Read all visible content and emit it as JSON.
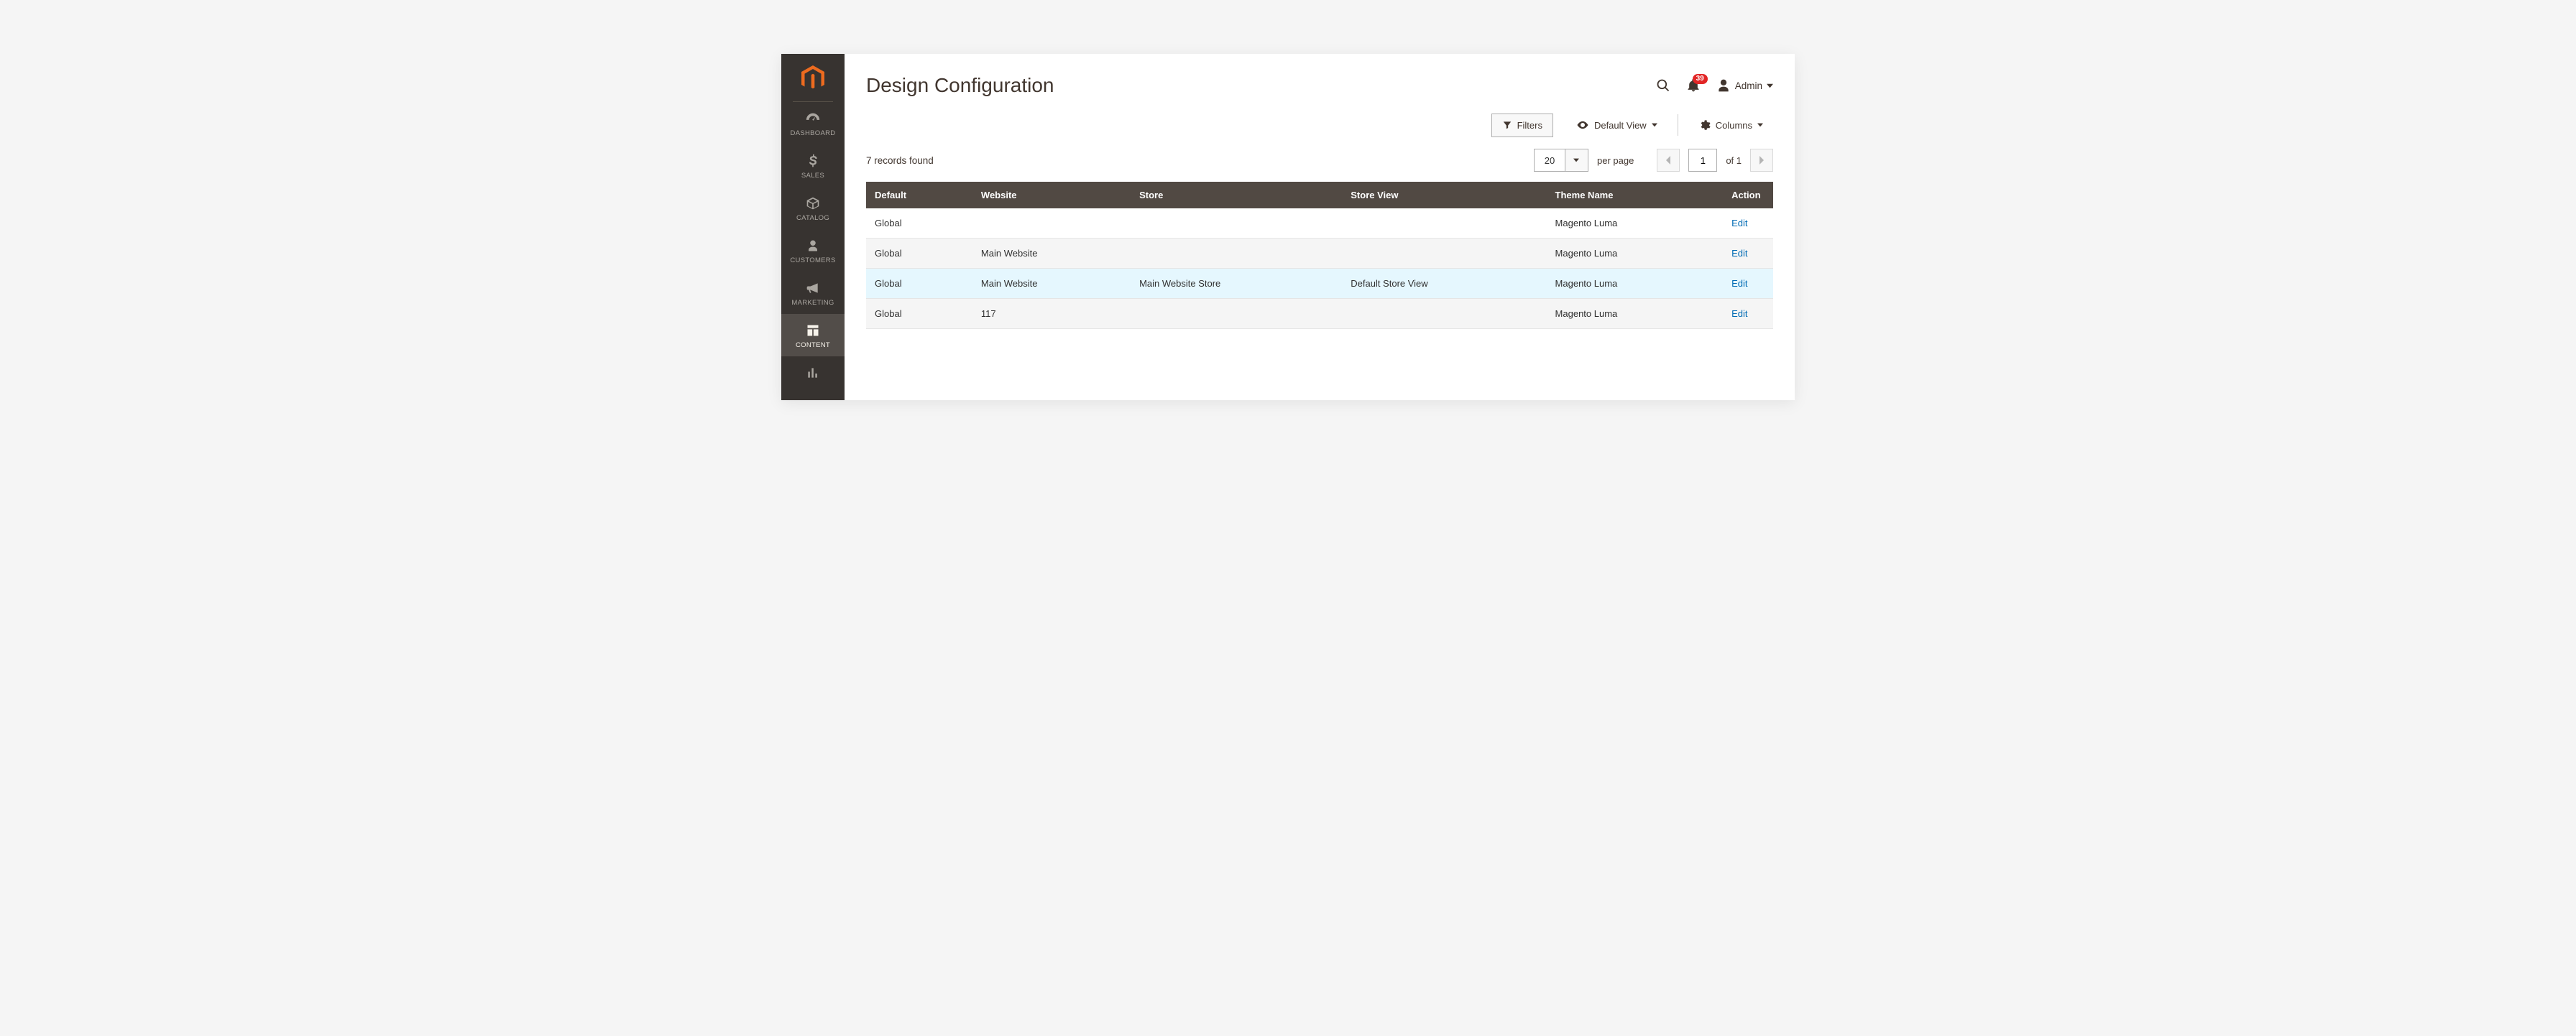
{
  "sidebar": {
    "items": [
      {
        "label": "DASHBOARD"
      },
      {
        "label": "SALES"
      },
      {
        "label": "CATALOG"
      },
      {
        "label": "CUSTOMERS"
      },
      {
        "label": "MARKETING"
      },
      {
        "label": "CONTENT"
      }
    ]
  },
  "header": {
    "title": "Design Configuration",
    "notification_count": "39",
    "admin_label": "Admin"
  },
  "toolbar": {
    "filters_label": "Filters",
    "default_view_label": "Default View",
    "columns_label": "Columns"
  },
  "pager": {
    "records_found": "7 records found",
    "page_size": "20",
    "per_page_label": "per page",
    "current_page": "1",
    "of_label": "of 1"
  },
  "table": {
    "headers": {
      "default": "Default",
      "website": "Website",
      "store": "Store",
      "store_view": "Store View",
      "theme_name": "Theme Name",
      "action": "Action"
    },
    "rows": [
      {
        "default": "Global",
        "website": "",
        "store": "",
        "store_view": "",
        "theme": "Magento Luma",
        "action": "Edit"
      },
      {
        "default": "Global",
        "website": "Main Website",
        "store": "",
        "store_view": "",
        "theme": "Magento Luma",
        "action": "Edit"
      },
      {
        "default": "Global",
        "website": "Main Website",
        "store": "Main Website Store",
        "store_view": "Default Store View",
        "theme": "Magento Luma",
        "action": "Edit",
        "highlight": true
      },
      {
        "default": "Global",
        "website": "117",
        "store": "",
        "store_view": "",
        "theme": "Magento Luma",
        "action": "Edit"
      }
    ]
  }
}
